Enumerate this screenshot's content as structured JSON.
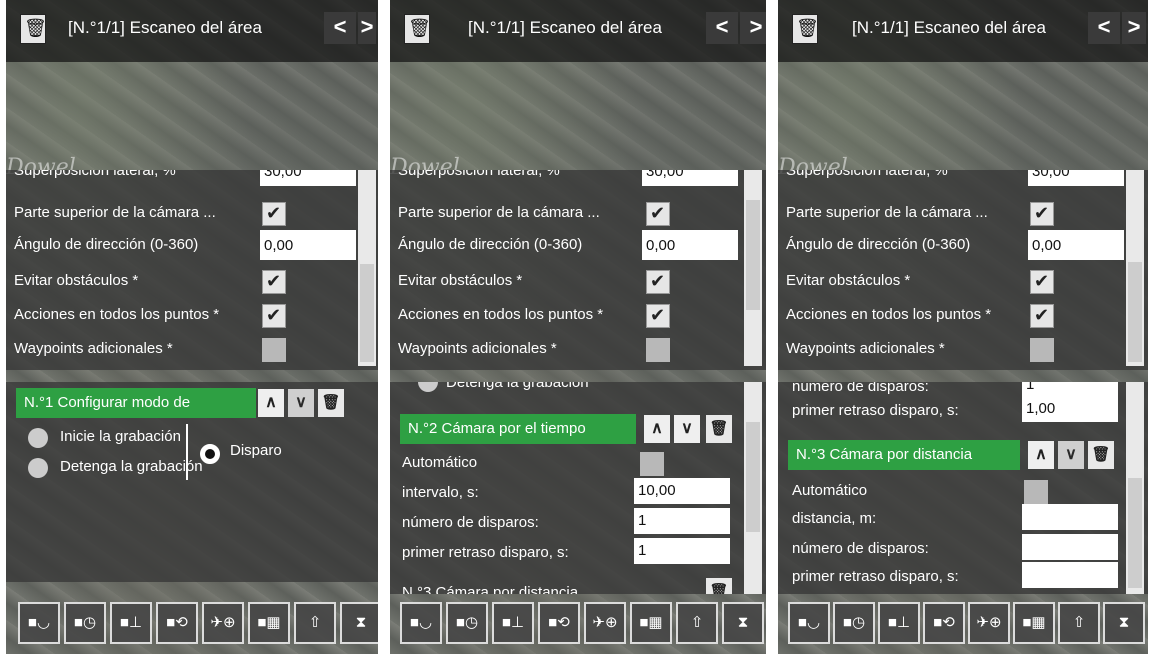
{
  "header": {
    "title": "[N.°1/1] Escaneo del área",
    "prev_label": "<",
    "next_label": ">"
  },
  "watermark": "Dowel",
  "settings": {
    "overlap_label": "Superposición lateral, %",
    "overlap_value": "30,00",
    "camera_top_label": "Parte superior de la cámara ...",
    "heading_label": "Ángulo de dirección (0-360)",
    "heading_value": "0,00",
    "avoid_obstacles_label": "Evitar obstáculos *",
    "actions_all_points_label": "Acciones en todos los puntos *",
    "extra_waypoints_label": "Waypoints adicionales *"
  },
  "panel1": {
    "action_title": "N.°1 Configurar modo de",
    "radio_start": "Inicie la grabación",
    "radio_stop": "Detenga la grabación",
    "radio_shot": "Disparo"
  },
  "panel2": {
    "partial_top": "Detenga la grabación",
    "action_title": "N.°2 Cámara por el tiempo",
    "auto_label": "Automático",
    "interval_label": "intervalo, s:",
    "interval_value": "10,00",
    "shots_label": "número de disparos:",
    "shots_value": "1",
    "delay_label": "primer retraso disparo, s:",
    "delay_value": "1",
    "next_title_partial": "N.°3 Cámara por distancia"
  },
  "panel3": {
    "shots_partial_label": "número de disparos:",
    "shots_partial_value": "1",
    "delay_label": "primer retraso disparo, s:",
    "delay_value": "1,00",
    "action_title": "N.°3 Cámara por distancia",
    "auto_label": "Automático",
    "distance_label": "distancia, m:",
    "distance_value": "",
    "shots_label": "número de disparos:",
    "shots_value": "",
    "delay2_label": "primer retraso disparo, s:",
    "delay2_value": ""
  },
  "icons": {
    "toolbar": [
      "camera-start-icon",
      "camera-timer-icon",
      "camera-distance-icon",
      "camera-rotate-icon",
      "drone-target-icon",
      "camera-grid-icon",
      "arrow-up-icon",
      "hourglass-icon"
    ]
  },
  "colors": {
    "action_header": "#2ea043",
    "panel_bg": "#373737",
    "text": "#ffffff"
  }
}
